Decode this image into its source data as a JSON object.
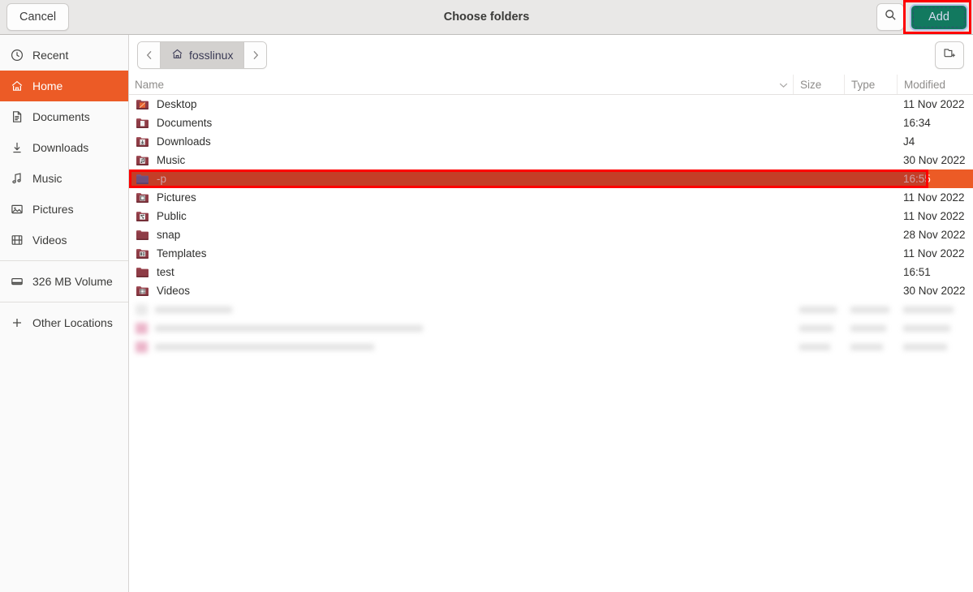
{
  "window": {
    "title": "Choose folders"
  },
  "header": {
    "cancel_label": "Cancel",
    "add_label": "Add",
    "search_icon": "search-icon",
    "accent_green": "#12795f",
    "annotation_color": "#fe0000"
  },
  "sidebar": {
    "items": [
      {
        "label": "Recent",
        "icon": "clock-icon",
        "selected": false
      },
      {
        "label": "Home",
        "icon": "home-icon",
        "selected": true
      },
      {
        "label": "Documents",
        "icon": "document-icon",
        "selected": false
      },
      {
        "label": "Downloads",
        "icon": "download-icon",
        "selected": false
      },
      {
        "label": "Music",
        "icon": "music-note-icon",
        "selected": false
      },
      {
        "label": "Pictures",
        "icon": "picture-icon",
        "selected": false
      },
      {
        "label": "Videos",
        "icon": "film-icon",
        "selected": false
      }
    ],
    "volumes": [
      {
        "label": "326 MB Volume",
        "icon": "drive-icon"
      }
    ],
    "other": {
      "label": "Other Locations",
      "icon": "plus-icon"
    },
    "selected_color": "#ec5b26"
  },
  "pathbar": {
    "back_icon": "chevron-left-icon",
    "forward_icon": "chevron-right-icon",
    "crumb_label": "fosslinux",
    "crumb_icon": "home-icon",
    "new_folder_icon": "new-folder-icon"
  },
  "columns": {
    "name": "Name",
    "size": "Size",
    "type": "Type",
    "modified": "Modified",
    "sort_icon": "chevron-down-icon"
  },
  "files": [
    {
      "name": "Desktop",
      "size": "",
      "type": "",
      "modified": "11 Nov 2022",
      "icon": "folder-desktop-icon",
      "selected": false
    },
    {
      "name": "Documents",
      "size": "",
      "type": "",
      "modified": "16:34",
      "icon": "folder-documents-icon",
      "selected": false
    },
    {
      "name": "Downloads",
      "size": "",
      "type": "",
      "modified": "J4",
      "icon": "folder-downloads-icon",
      "selected": false
    },
    {
      "name": "Music",
      "size": "",
      "type": "",
      "modified": "30 Nov 2022",
      "icon": "folder-music-icon",
      "selected": false
    },
    {
      "name": "-p",
      "size": "",
      "type": "",
      "modified": "16:55",
      "icon": "folder-blue-icon",
      "selected": true
    },
    {
      "name": "Pictures",
      "size": "",
      "type": "",
      "modified": "11 Nov 2022",
      "icon": "folder-pictures-icon",
      "selected": false
    },
    {
      "name": "Public",
      "size": "",
      "type": "",
      "modified": "11 Nov 2022",
      "icon": "folder-public-icon",
      "selected": false
    },
    {
      "name": "snap",
      "size": "",
      "type": "",
      "modified": "28 Nov 2022",
      "icon": "folder-icon",
      "selected": false
    },
    {
      "name": "Templates",
      "size": "",
      "type": "",
      "modified": "11 Nov 2022",
      "icon": "folder-templates-icon",
      "selected": false
    },
    {
      "name": "test",
      "size": "",
      "type": "",
      "modified": "16:51",
      "icon": "folder-icon",
      "selected": false
    },
    {
      "name": "Videos",
      "size": "",
      "type": "",
      "modified": "30 Nov 2022",
      "icon": "folder-videos-icon",
      "selected": false
    }
  ],
  "redacted_rows": 3
}
